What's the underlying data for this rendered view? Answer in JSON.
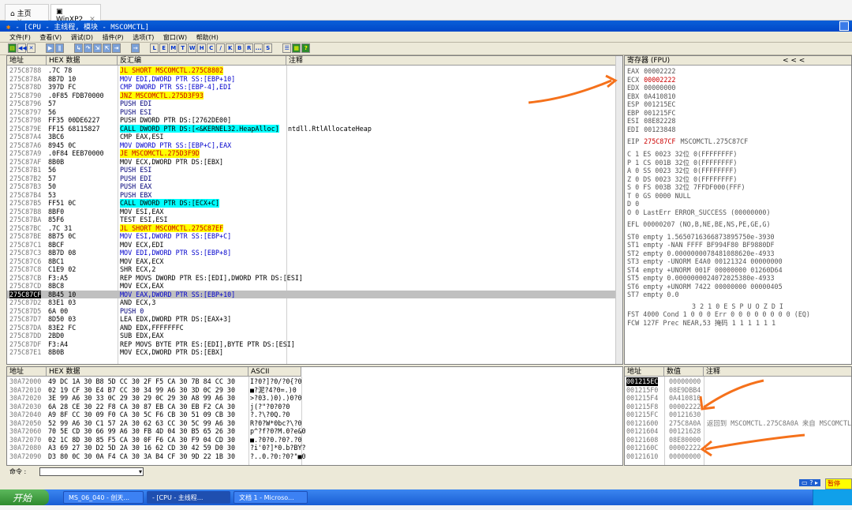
{
  "browser_tabs": [
    {
      "label": "主页",
      "active": false
    },
    {
      "label": "WinXP2",
      "active": true
    }
  ],
  "title": "- [CPU - 主线程, 模块 - MSCOMCTL]",
  "menu": [
    "文件(F)",
    "查看(V)",
    "调试(D)",
    "插件(P)",
    "选项(T)",
    "窗口(W)",
    "帮助(H)"
  ],
  "toolbar": [
    "L",
    "E",
    "M",
    "T",
    "W",
    "H",
    "C",
    "/",
    "K",
    "B",
    "R",
    "...",
    "S"
  ],
  "disasm_headers": {
    "addr": "地址",
    "hex": "HEX 数据",
    "dis": "反汇编",
    "note": "注释"
  },
  "disasm": [
    [
      "275C8788",
      ".7C 78",
      "JL SHORT MSCOMCTL.275C8802",
      "",
      "jl"
    ],
    [
      "275C878A",
      "8B7D 10",
      "MOV EDI,DWORD PTR SS:[EBP+10]",
      "",
      "c"
    ],
    [
      "275C878D",
      "397D FC",
      "CMP DWORD PTR SS:[EBP-4],EDI",
      "",
      "c"
    ],
    [
      "275C8790",
      ".0F85 FDB70000",
      "JNZ MSCOMCTL.275D3F93",
      "",
      "jl"
    ],
    [
      "275C8796",
      "57",
      "PUSH EDI",
      "",
      "push"
    ],
    [
      "275C8797",
      "56",
      "PUSH ESI",
      "",
      "push"
    ],
    [
      "275C8798",
      "FF35 00DE6227",
      "PUSH DWORD PTR DS:[2762DE00]",
      "",
      ""
    ],
    [
      "275C879E",
      "FF15 68115827",
      "CALL DWORD PTR DS:[<&KERNEL32.HeapAlloc]",
      "ntdll.RtlAllocateHeap",
      "call"
    ],
    [
      "275C87A4",
      "3BC6",
      "CMP EAX,ESI",
      "",
      ""
    ],
    [
      "275C87A6",
      "8945 0C",
      "MOV DWORD PTR SS:[EBP+C],EAX",
      "",
      "c"
    ],
    [
      "275C87A9",
      ".0F84 EEB70000",
      "JE MSCOMCTL.275D3F9D",
      "",
      "jl"
    ],
    [
      "275C87AF",
      "8B0B",
      "MOV ECX,DWORD PTR DS:[EBX]",
      "",
      ""
    ],
    [
      "275C87B1",
      "56",
      "PUSH ESI",
      "",
      "push"
    ],
    [
      "275C87B2",
      "57",
      "PUSH EDI",
      "",
      "push"
    ],
    [
      "275C87B3",
      "50",
      "PUSH EAX",
      "",
      "push"
    ],
    [
      "275C87B4",
      "53",
      "PUSH EBX",
      "",
      "push"
    ],
    [
      "275C87B5",
      "FF51 0C",
      "CALL DWORD PTR DS:[ECX+C]",
      "",
      "call"
    ],
    [
      "275C87B8",
      "8BF0",
      "MOV ESI,EAX",
      "",
      ""
    ],
    [
      "275C87BA",
      "85F6",
      "TEST ESI,ESI",
      "",
      ""
    ],
    [
      "275C87BC",
      ".7C 31",
      "JL SHORT MSCOMCTL.275C87EF",
      "",
      "jl"
    ],
    [
      "275C87BE",
      "8B75 0C",
      "MOV ESI,DWORD PTR SS:[EBP+C]",
      "",
      "c"
    ],
    [
      "275C87C1",
      "8BCF",
      "MOV ECX,EDI",
      "",
      ""
    ],
    [
      "275C87C3",
      "8B7D 08",
      "MOV EDI,DWORD PTR SS:[EBP+8]",
      "",
      "c"
    ],
    [
      "275C87C6",
      "8BC1",
      "MOV EAX,ECX",
      "",
      ""
    ],
    [
      "275C87C8",
      "C1E9 02",
      "SHR ECX,2",
      "",
      ""
    ],
    [
      "275C87CB",
      "F3:A5",
      "REP MOVS DWORD PTR ES:[EDI],DWORD PTR DS:[ESI]",
      "",
      ""
    ],
    [
      "275C87CD",
      "8BC8",
      "MOV ECX,EAX",
      "",
      ""
    ],
    [
      "275C87CF",
      "8B45 10",
      "MOV EAX,DWORD PTR SS:[EBP+10]",
      "",
      "c"
    ],
    [
      "275C87D2",
      "83E1 03",
      "AND ECX,3",
      "",
      ""
    ],
    [
      "275C87D5",
      "6A 00",
      "PUSH 0",
      "",
      "push"
    ],
    [
      "275C87D7",
      "8D50 03",
      "LEA EDX,DWORD PTR DS:[EAX+3]",
      "",
      ""
    ],
    [
      "275C87DA",
      "83E2 FC",
      "AND EDX,FFFFFFFC",
      "",
      ""
    ],
    [
      "275C87DD",
      "2BD0",
      "SUB EDX,EAX",
      "",
      ""
    ],
    [
      "275C87DF",
      "F3:A4",
      "REP MOVS BYTE PTR ES:[EDI],BYTE PTR DS:[ESI]",
      "",
      ""
    ],
    [
      "275C87E1",
      "8B0B",
      "MOV ECX,DWORD PTR DS:[EBX]",
      "",
      ""
    ]
  ],
  "selected_addr": "275C87CF",
  "reg_header": "寄存器 (FPU)",
  "reg_nav": "<   <   <",
  "registers": [
    [
      "EAX",
      "00002222",
      ""
    ],
    [
      "ECX",
      "00002222",
      "red"
    ],
    [
      "EDX",
      "00000000",
      ""
    ],
    [
      "EBX",
      "0A410810",
      ""
    ],
    [
      "ESP",
      "001215EC",
      ""
    ],
    [
      "EBP",
      "001215FC",
      ""
    ],
    [
      "ESI",
      "08E82228",
      ""
    ],
    [
      "EDI",
      "00123848",
      ""
    ]
  ],
  "eip": {
    "label": "EIP",
    "value": "275C87CF",
    "sym": "MSCOMCTL.275C87CF"
  },
  "flags": [
    "C 1  ES 0023 32位 0(FFFFFFFF)",
    "P 1  CS 001B 32位 0(FFFFFFFF)",
    "A 0  SS 0023 32位 0(FFFFFFFF)",
    "Z 0  DS 0023 32位 0(FFFFFFFF)",
    "S 0  FS 003B 32位 7FFDF000(FFF)",
    "T 0  GS 0000 NULL",
    "D 0",
    "O 0  LastErr ERROR_SUCCESS (00000000)"
  ],
  "efl": "EFL 00000207 (NO,B,NE,BE,NS,PE,GE,G)",
  "fpu": [
    "ST0 empty 1.5650716366873895750e-3930",
    "ST1 empty -NAN FFFF BF994F80 BF9880DF",
    "ST2 empty 0.0000000078481088620e-4933",
    "ST3 empty -UNORM E4A0 00121324 00000000",
    "ST4 empty +UNORM 001F 00000000 01260D64",
    "ST5 empty 0.0000000024072025380e-4933",
    "ST6 empty +UNORM 7422 00000000 00000405",
    "ST7 empty 0.0"
  ],
  "fpu_bits": "3 2 1 0      E S P U O Z D I",
  "fst": "FST 4000  Cond 1 0 0 0  Err 0 0 0 0 0 0 0 0  (EQ)",
  "fcw": "FCW 127F  Prec NEAR,53  掩码    1 1 1 1 1 1",
  "dump_headers": {
    "addr": "地址",
    "hex": "HEX 数据",
    "ascii": "ASCII"
  },
  "dump": [
    [
      "30A72000",
      "49 DC 1A 30 B8 5D CC 30 2F F5 CA 30 7B 84 CC 30",
      "I?0?]?0/?0{?0"
    ],
    [
      "30A72010",
      "02 19 CF 30 E4 B7 CC 30 34 99 A6 30 3D 0C 29 30",
      "■?泥?4?0=.)0"
    ],
    [
      "30A72020",
      "3E 99 A6 30 33 0C 29 30 29 0C 29 30 A8 99 A6 30",
      ">?03.)0).)0?0"
    ],
    [
      "30A72030",
      "6A 28 CE 30 22 F8 CA 30 87 EB CA 30 EB F2 CA 30",
      "j(?\"?0?0?0"
    ],
    [
      "30A72040",
      "A9 8F CC 30 09 F0 CA 30 5C F6 CB 30 51 09 CB 30",
      "?.?\\?0Q.?0"
    ],
    [
      "30A72050",
      "52 99 A6 30 C1 57 2A 30 62 63 CC 30 5C 99 A6 30",
      "R?0?W*0bc?\\?0"
    ],
    [
      "30A72060",
      "70 5E CD 30 66 99 A6 30 FB 4D 04 30 B5 65 26 30",
      "p^?f?0?M.0?e&0"
    ],
    [
      "30A72070",
      "02 1C 8D 30 85 F5 CA 30 0F F6 CA 30 F9 04 CD 30",
      "■.?0?0.?0?.?0"
    ],
    [
      "30A72080",
      "A3 69 27 30 D2 5D 2A 30 16 62 CD 30 42 59 D0 30",
      "?i'0?]*0.b?BY?"
    ],
    [
      "30A72090",
      "D3 80 0C 30 0A F4 CA 30 3A B4 CF 30 9D 22 1B 30",
      "?..0.?0:?0?\"■0"
    ]
  ],
  "stack_headers": {
    "addr": "地址",
    "val": "数值",
    "note": "注释"
  },
  "stack": [
    [
      "001215EC",
      "00000000",
      "",
      true
    ],
    [
      "001215F0",
      "08E9DBB4",
      "",
      false
    ],
    [
      "001215F4",
      "0A410810",
      "",
      false
    ],
    [
      "001215F8",
      "00002222",
      "",
      false
    ],
    [
      "001215FC",
      "00121630",
      "",
      false
    ],
    [
      "00121600",
      "275C8A0A",
      "返回到 MSCOMCTL.275C8A0A 来自 MSCOMCTL",
      false
    ],
    [
      "00121604",
      "00121628",
      "",
      false
    ],
    [
      "00121608",
      "08E80000",
      "",
      false
    ],
    [
      "0012160C",
      "00002222",
      "",
      false
    ],
    [
      "00121610",
      "00000000",
      "",
      false
    ]
  ],
  "command": {
    "label": "命令 :",
    "value": ""
  },
  "status_pause": "暂停",
  "taskbar": {
    "start": "开始",
    "tasks": [
      "MS_06_040 - 创天...",
      "- [CPU - 主线程...",
      "文档 1 - Microso..."
    ]
  }
}
